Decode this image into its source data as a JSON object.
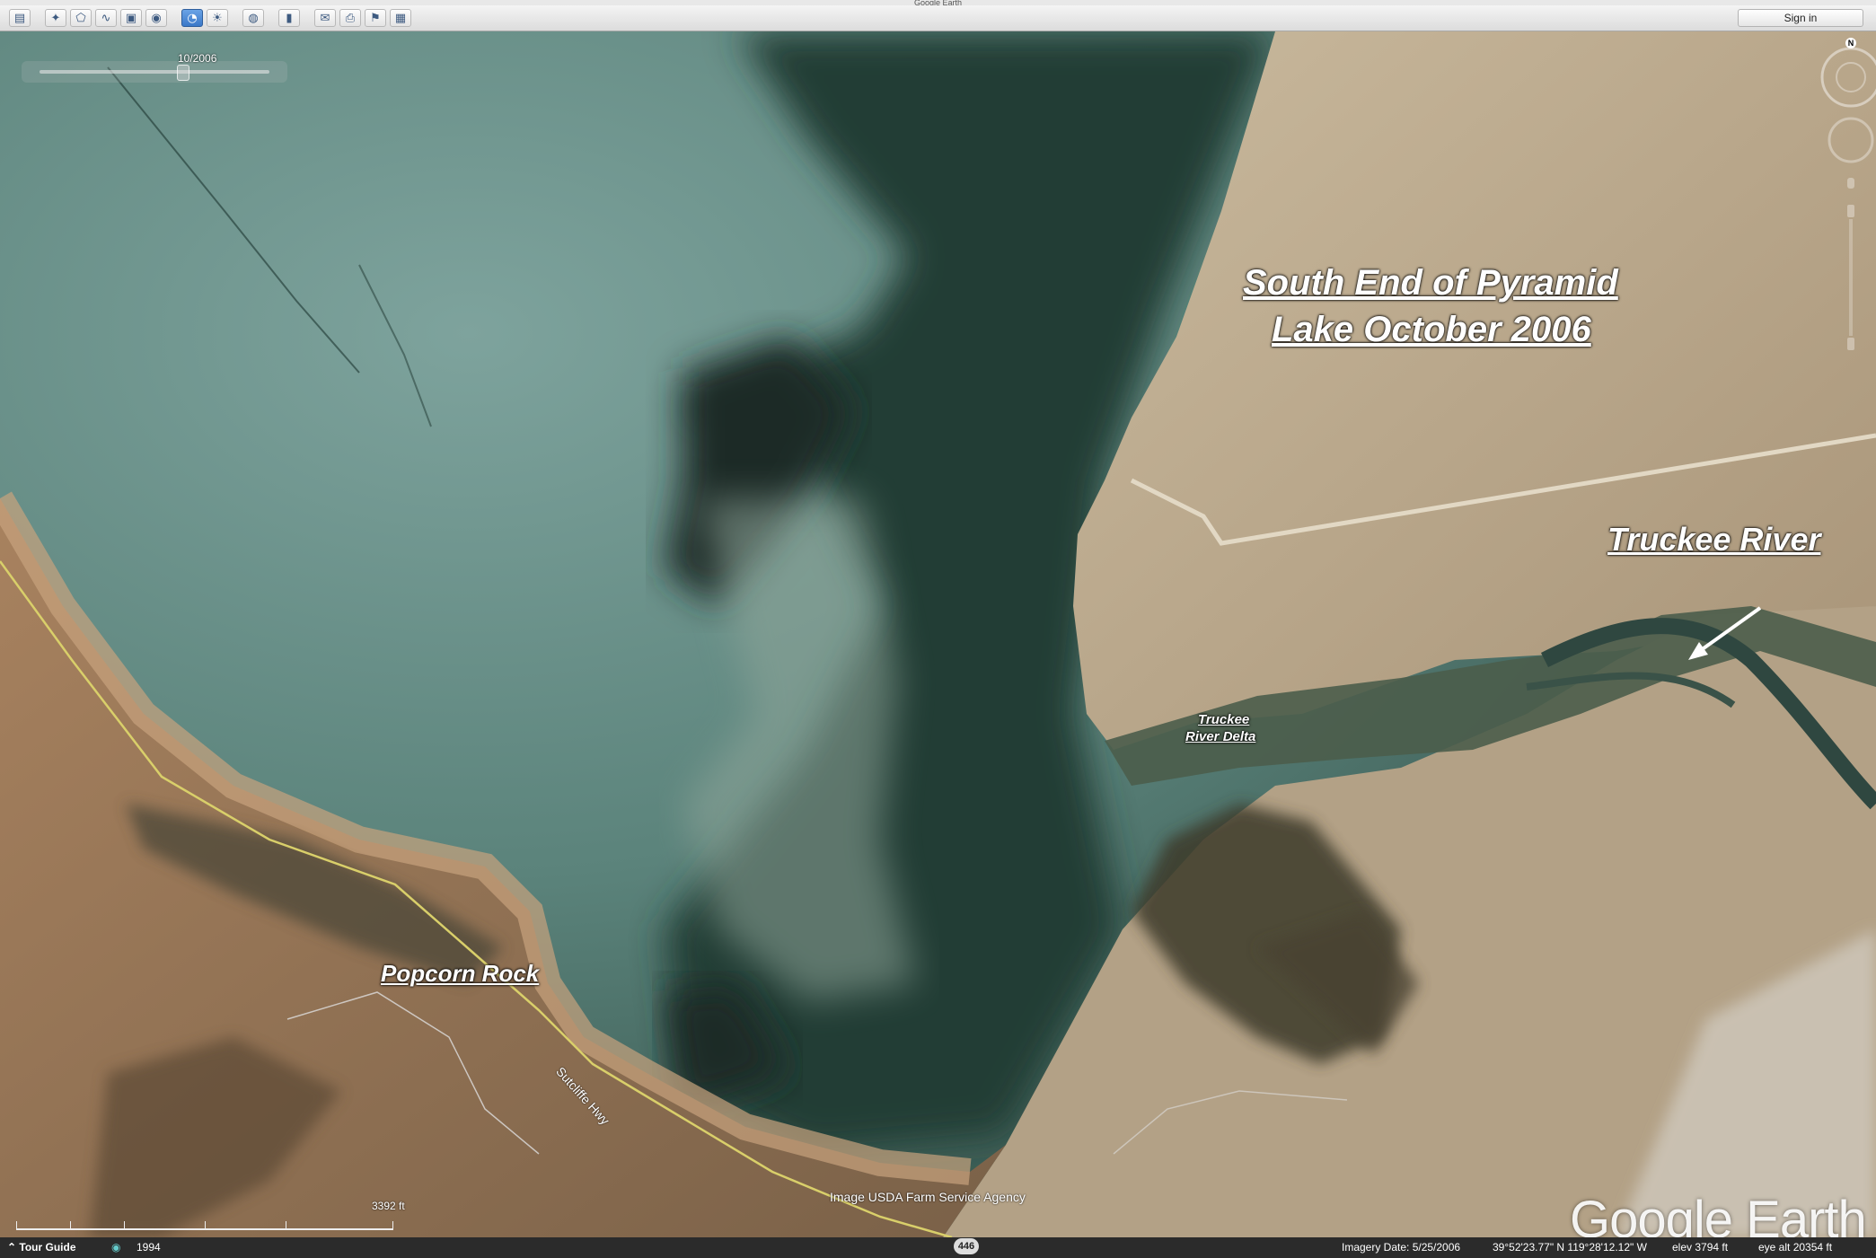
{
  "window": {
    "title": "Google Earth"
  },
  "toolbar": {
    "buttons": [
      {
        "name": "sidebar-toggle-icon",
        "glyph": "▤"
      },
      {
        "name": "placemark-icon",
        "glyph": "✦"
      },
      {
        "name": "polygon-icon",
        "glyph": "⬠"
      },
      {
        "name": "path-icon",
        "glyph": "∿"
      },
      {
        "name": "image-overlay-icon",
        "glyph": "▣"
      },
      {
        "name": "record-tour-icon",
        "glyph": "◉"
      },
      {
        "name": "historical-imagery-icon",
        "glyph": "◔"
      },
      {
        "name": "sunlight-icon",
        "glyph": "☀"
      },
      {
        "name": "planets-icon",
        "glyph": "◍"
      },
      {
        "name": "ruler-icon",
        "glyph": "▮"
      },
      {
        "name": "email-icon",
        "glyph": "✉"
      },
      {
        "name": "print-icon",
        "glyph": "⎙"
      },
      {
        "name": "google-maps-icon",
        "glyph": "⚑"
      },
      {
        "name": "save-image-icon",
        "glyph": "▦"
      }
    ],
    "sign_in_label": "Sign in"
  },
  "time_slider": {
    "date_label": "10/2006",
    "position": 0.62
  },
  "map": {
    "labels": {
      "title_line1": "South End of Pyramid",
      "title_line2": "Lake October 2006",
      "truckee_river": "Truckee River",
      "delta_line1": "Truckee",
      "delta_line2": "River Delta",
      "popcorn_rock": "Popcorn Rock",
      "road": "Sutcliffe Hwy"
    },
    "credit": "Image USDA Farm Service Agency",
    "logo": "Google Earth",
    "scale_label": "3392 ft",
    "compass_label": "N",
    "route_shield": "446"
  },
  "status_bar": {
    "tour_guide": "Tour Guide",
    "year": "1994",
    "imagery_date": "Imagery Date: 5/25/2006",
    "coords": "39°52'23.77\" N  119°28'12.12\" W",
    "elev": "elev  3794 ft",
    "eye_alt": "eye alt  20354 ft"
  },
  "colors": {
    "lake_light": "#6f9590",
    "lake_dark": "#1f3a33",
    "land": "#b9a88c",
    "land_dark": "#6d5a44",
    "status_bg": "#2b2b2b"
  }
}
